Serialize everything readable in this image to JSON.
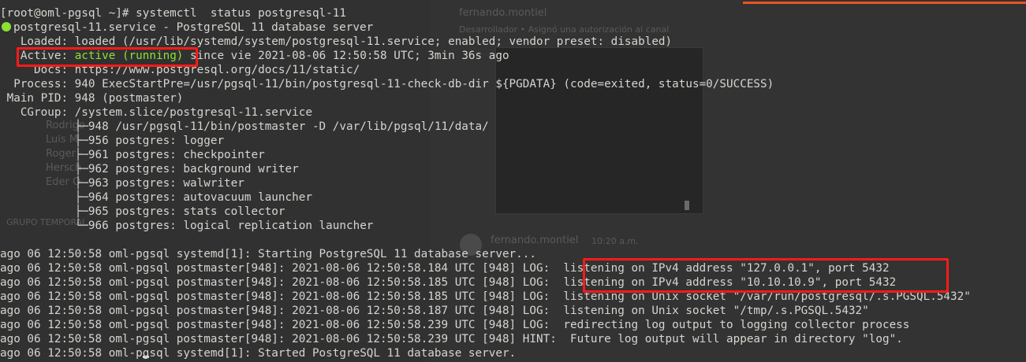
{
  "background_window": {
    "user_name": "fernando.montiel",
    "subtitle": "Desarrollador • Asignó una autorización al canal",
    "sidebar_items": [
      "Rodrigo",
      "Luis M",
      "Roger",
      "Hersch",
      "Eder O"
    ],
    "group_label": "GRUPO TEMPORAL",
    "message_author": "fernando.montiel",
    "message_time": "10:20 a.m."
  },
  "terminal": {
    "prompt_line": "[root@oml-pgsql ~]# systemctl  status postgresql-11",
    "service_line": "postgresql-11.service - PostgreSQL 11 database server",
    "loaded_line": "   Loaded: loaded (/usr/lib/systemd/system/postgresql-11.service; enabled; vendor preset: disabled)",
    "active_label": "   Active: ",
    "active_state": "active (running)",
    "active_since": " since vie 2021-08-06 12:50:58 UTC; 3min 36s ago",
    "docs_line": "     Docs: https://www.postgresql.org/docs/11/static/",
    "process_line": "  Process: 940 ExecStartPre=/usr/pgsql-11/bin/postgresql-11-check-db-dir ${PGDATA} (code=exited, status=0/SUCCESS)",
    "mainpid_line": " Main PID: 948 (postmaster)",
    "cgroup_line": "   CGroup: /system.slice/postgresql-11.service",
    "cgroup_tree": [
      "           ├─948 /usr/pgsql-11/bin/postmaster -D /var/lib/pgsql/11/data/",
      "           ├─956 postgres: logger",
      "           ├─961 postgres: checkpointer",
      "           ├─962 postgres: background writer",
      "           ├─963 postgres: walwriter",
      "           ├─964 postgres: autovacuum launcher",
      "           ├─965 postgres: stats collector",
      "           └─966 postgres: logical replication launcher"
    ],
    "log_lines": [
      "ago 06 12:50:58 oml-pgsql systemd[1]: Starting PostgreSQL 11 database server...",
      "ago 06 12:50:58 oml-pgsql postmaster[948]: 2021-08-06 12:50:58.184 UTC [948] LOG:  listening on IPv4 address \"127.0.0.1\", port 5432",
      "ago 06 12:50:58 oml-pgsql postmaster[948]: 2021-08-06 12:50:58.185 UTC [948] LOG:  listening on IPv4 address \"10.10.10.9\", port 5432",
      "ago 06 12:50:58 oml-pgsql postmaster[948]: 2021-08-06 12:50:58.185 UTC [948] LOG:  listening on Unix socket \"/var/run/postgresql/.s.PGSQL.5432\"",
      "ago 06 12:50:58 oml-pgsql postmaster[948]: 2021-08-06 12:50:58.187 UTC [948] LOG:  listening on Unix socket \"/tmp/.s.PGSQL.5432\"",
      "ago 06 12:50:58 oml-pgsql postmaster[948]: 2021-08-06 12:50:58.239 UTC [948] LOG:  redirecting log output to logging collector process",
      "ago 06 12:50:58 oml-pgsql postmaster[948]: 2021-08-06 12:50:58.239 UTC [948] HINT:  Future log output will appear in directory \"log\".",
      "ago 06 12:50:58 oml-pgsql systemd[1]: Started PostgreSQL 11 database server."
    ]
  },
  "colors": {
    "terminal_text": "#d3d7cf",
    "active_green": "#8ae234",
    "highlight_red": "#ff1a1a",
    "accent_orange": "#e95420"
  }
}
